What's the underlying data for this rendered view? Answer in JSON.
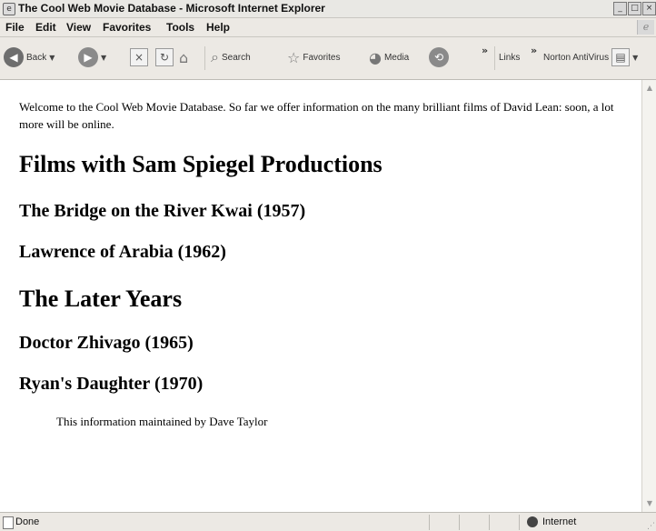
{
  "window": {
    "title": "The Cool Web Movie Database - Microsoft Internet Explorer"
  },
  "menu": [
    "File",
    "Edit",
    "View",
    "Favorites",
    "Tools",
    "Help"
  ],
  "toolbar": {
    "back_label": "Back",
    "search_label": "Search",
    "favorites_label": "Favorites",
    "media_label": "Media",
    "links_label": "Links",
    "norton_label": "Norton AntiVirus",
    "overflow_glyph": "»"
  },
  "content": {
    "intro": "Welcome to the Cool Web Movie Database. So far we offer information on the many brilliant films of David Lean: soon, a lot more will be online.",
    "section1_title": "Films with Sam Spiegel Productions",
    "film1": "The Bridge on the River Kwai (1957)",
    "film2": "Lawrence of Arabia (1962)",
    "section2_title": "The Later Years",
    "film3": "Doctor Zhivago (1965)",
    "film4": "Ryan's Daughter (1970)",
    "footer": "This information maintained by Dave Taylor"
  },
  "status": {
    "text": "Done",
    "zone": "Internet"
  },
  "icons": {
    "app": "ie-page-icon",
    "back": "back-arrow-icon",
    "forward": "forward-arrow-icon",
    "stop": "stop-icon",
    "refresh": "refresh-icon",
    "home": "home-icon",
    "search": "search-magnifier-icon",
    "favorites": "star-icon",
    "media": "media-icon",
    "history": "history-icon",
    "norton": "norton-icon",
    "status_page": "page-icon",
    "internet_zone": "globe-icon"
  }
}
